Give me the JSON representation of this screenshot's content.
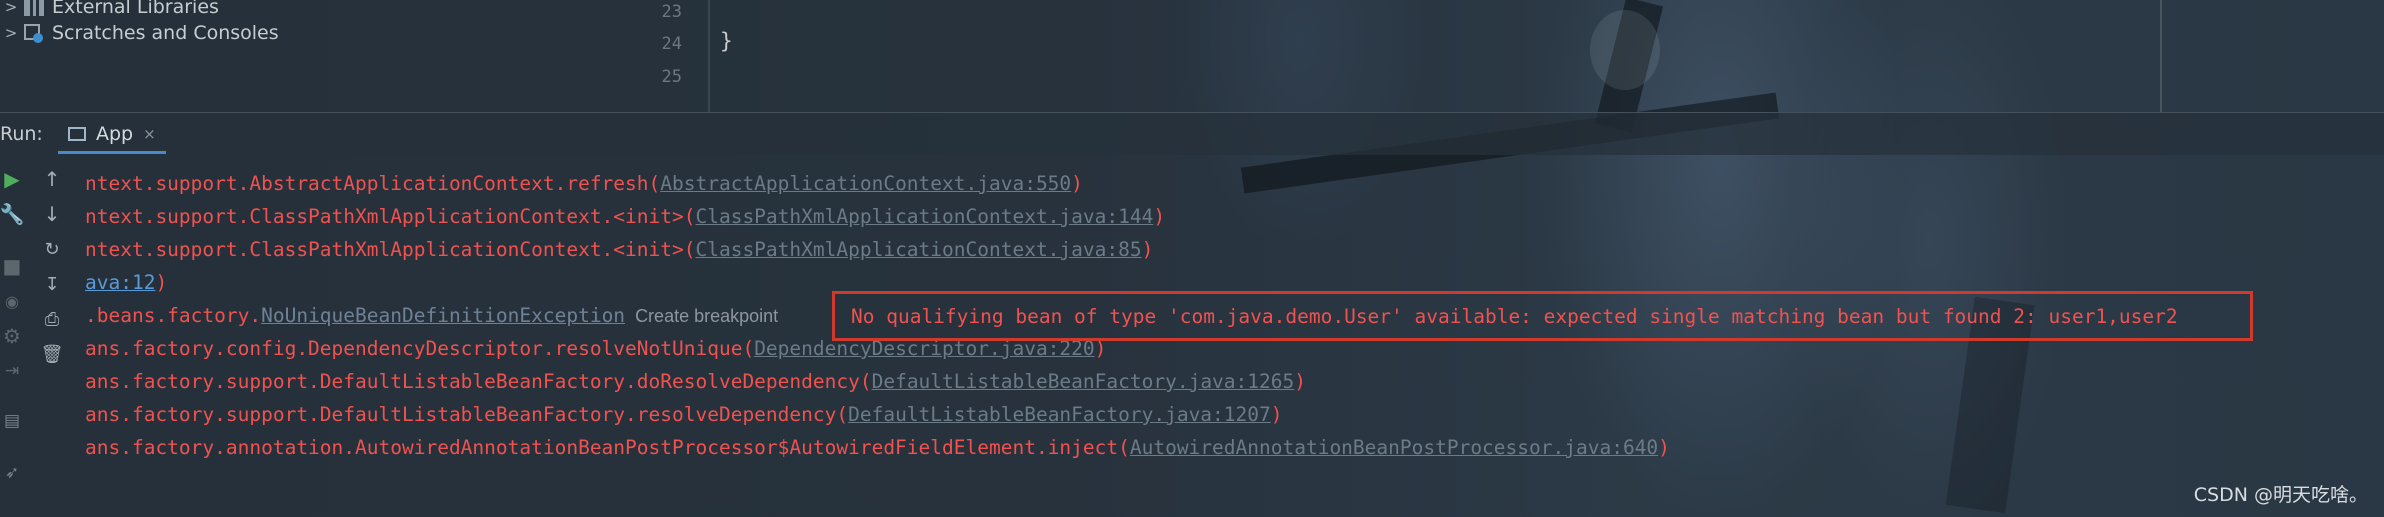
{
  "project_tree": {
    "items": [
      {
        "label": "External Libraries",
        "icon": "library-icon"
      },
      {
        "label": "Scratches and Consoles",
        "icon": "scratches-icon"
      }
    ]
  },
  "editor": {
    "line_numbers": [
      "23",
      "24",
      "25"
    ],
    "code_line_24": "}"
  },
  "run_panel": {
    "label": "Run:",
    "tab": {
      "label": "App",
      "close": "×",
      "icon": "application-icon"
    }
  },
  "toolbar": {
    "left_tools": [
      "run-icon",
      "wrench-icon",
      "stop-icon",
      "camera-icon",
      "gear-icon",
      "exit-icon",
      "layout-icon",
      "pin-icon"
    ],
    "console_tools": [
      "up-arrow-icon",
      "down-arrow-icon",
      "soft-wrap-icon",
      "scroll-to-end-icon",
      "print-icon",
      "trash-icon"
    ]
  },
  "console": {
    "line1": {
      "text": "ntext.support.AbstractApplicationContext.refresh(",
      "link": "AbstractApplicationContext.java:550",
      "end": ")"
    },
    "line2": {
      "text": "ntext.support.ClassPathXmlApplicationContext.<init>(",
      "link": "ClassPathXmlApplicationContext.java:144",
      "end": ")"
    },
    "line3": {
      "text": "ntext.support.ClassPathXmlApplicationContext.<init>(",
      "link": "ClassPathXmlApplicationContext.java:85",
      "end": ")"
    },
    "line4": {
      "link": "ava:12",
      "end": ")"
    },
    "line5": {
      "text": ".beans.factory.",
      "link": "NoUniqueBeanDefinitionException",
      "hint": "Create breakpoint"
    },
    "line6": {
      "text": "ans.factory.config.DependencyDescriptor.resolveNotUnique(",
      "link": "DependencyDescriptor.java:220",
      "end": ")"
    },
    "line7": {
      "text": "ans.factory.support.DefaultListableBeanFactory.doResolveDependency(",
      "link": "DefaultListableBeanFactory.java:1265",
      "end": ")"
    },
    "line8": {
      "text": "ans.factory.support.DefaultListableBeanFactory.resolveDependency(",
      "link": "DefaultListableBeanFactory.java:1207",
      "end": ")"
    },
    "line9": {
      "text": "ans.factory.annotation.AutowiredAnnotationBeanPostProcessor$AutowiredFieldElement.inject(",
      "link": "AutowiredAnnotationBeanPostProcessor.java:640",
      "end": ")"
    },
    "error_message": "No qualifying bean of type 'com.java.demo.User' available: expected single matching bean but found 2: user1,user2"
  },
  "watermark": "CSDN @明天吃啥。",
  "colors": {
    "error_text": "#f0524f",
    "highlight_box": "#d03a2d",
    "link": "#6c7b88",
    "tab_underline": "#4a88c7"
  }
}
